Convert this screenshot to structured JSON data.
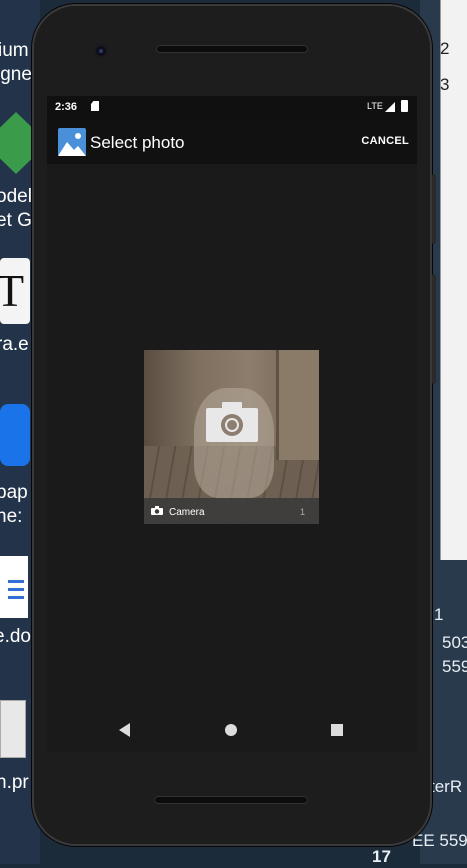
{
  "desktop": {
    "left_labels": [
      "ium",
      "igne",
      "odel",
      "et G",
      "ra.e",
      "pap",
      "ne:",
      "e.do",
      "n.pr"
    ],
    "right_labels": [
      "2",
      "3",
      "1",
      "503",
      "559",
      "terR",
      "EE 559",
      "17"
    ]
  },
  "status_bar": {
    "time": "2:36",
    "network": "LTE"
  },
  "toolbar": {
    "title": "Select photo",
    "cancel_label": "CANCEL"
  },
  "album": {
    "name": "Camera",
    "count": "1"
  },
  "colors": {
    "screen_bg": "#1a1a1a",
    "toolbar_bg": "#111111",
    "app_icon_blue": "#4a90d9"
  },
  "icons": {
    "app": "photo-icon",
    "album_overlay": "camera-icon",
    "album_label": "camera-small-icon",
    "nav": [
      "back-icon",
      "home-icon",
      "recents-icon"
    ]
  }
}
